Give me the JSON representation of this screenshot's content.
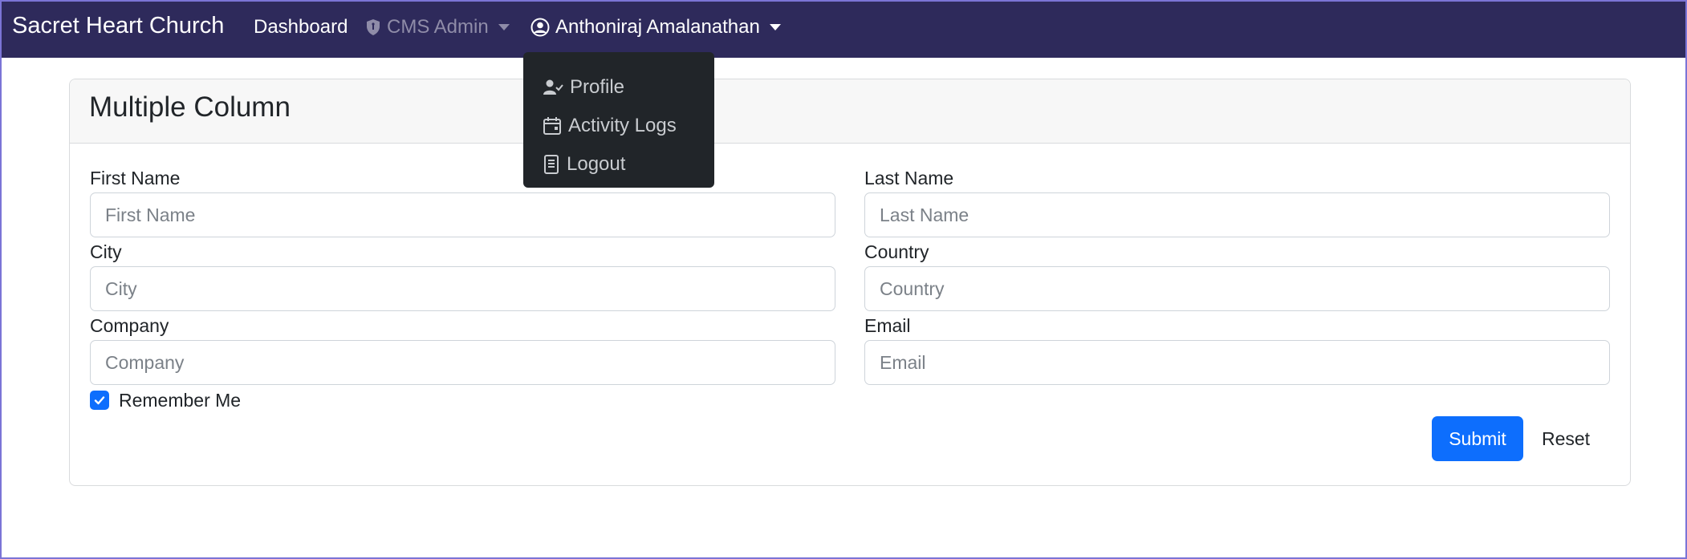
{
  "navbar": {
    "brand": "Sacret Heart Church",
    "dashboard": "Dashboard",
    "cms_admin": "CMS Admin",
    "user_name": "Anthoniraj Amalanathan",
    "bg_color": "#2e2a5b"
  },
  "user_menu": {
    "items": [
      {
        "label": "Profile",
        "icon": "user-check-icon"
      },
      {
        "label": "Activity Logs",
        "icon": "calendar-icon"
      },
      {
        "label": "Logout",
        "icon": "document-icon"
      }
    ]
  },
  "form": {
    "title": "Multiple Column",
    "fields": [
      {
        "label": "First Name",
        "placeholder": "First Name",
        "value": ""
      },
      {
        "label": "Last Name",
        "placeholder": "Last Name",
        "value": ""
      },
      {
        "label": "City",
        "placeholder": "City",
        "value": ""
      },
      {
        "label": "Country",
        "placeholder": "Country",
        "value": ""
      },
      {
        "label": "Company",
        "placeholder": "Company",
        "value": ""
      },
      {
        "label": "Email",
        "placeholder": "Email",
        "value": ""
      }
    ],
    "remember_me": "Remember Me",
    "remember_checked": true,
    "submit": "Submit",
    "reset": "Reset",
    "accent_color": "#0d6efd"
  }
}
